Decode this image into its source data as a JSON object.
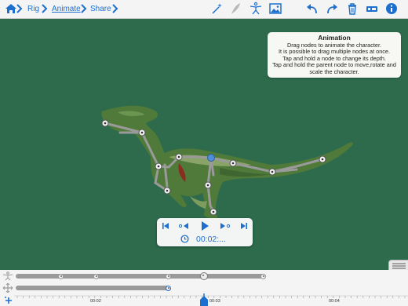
{
  "breadcrumb": {
    "rig": "Rig",
    "animate": "Animate",
    "share": "Share"
  },
  "toolbar_icons": [
    "home-icon",
    "magic-wand-icon",
    "feather-icon",
    "skeleton-figure-icon",
    "image-icon",
    "undo-icon",
    "redo-icon",
    "trash-icon",
    "record-icon",
    "info-icon"
  ],
  "tooltip": {
    "title": "Animation",
    "lines": [
      "Drag nodes to animate the character.",
      "It is possible to drag multiple nodes at once.",
      "Tap and hold a node to change its depth.",
      "Tap and hold the parent node to move,rotate and",
      "scale the character."
    ]
  },
  "player": {
    "time": "00:02:..."
  },
  "timeline": {
    "ruler_labels": [
      "00:02",
      "00:03",
      "00:04"
    ]
  },
  "colors": {
    "accent": "#1c6fcf",
    "background": "#2e6b4d"
  }
}
